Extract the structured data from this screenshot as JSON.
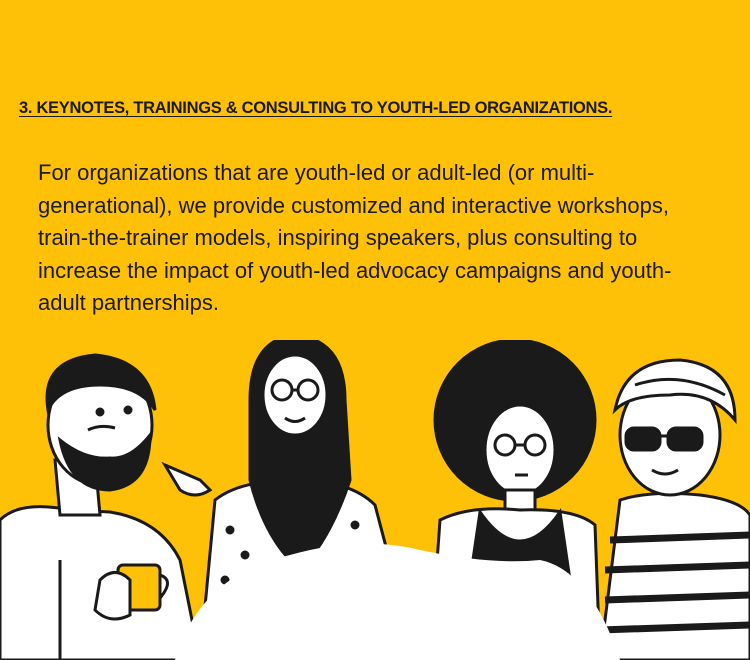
{
  "section": {
    "heading": "3. KEYNOTES, TRAININGS & CONSULTING TO YOUTH-LED ORGANIZATIONS.",
    "body": "For organizations that are youth-led or adult-led (or multi-generational), we provide customized and interactive workshops, train-the-trainer models, inspiring speakers, plus consulting to increase the impact of youth-led advocacy campaigns and youth-adult partnerships."
  },
  "colors": {
    "background": "#FFC107",
    "ink": "#1a1a1a",
    "paper": "#ffffff",
    "mug": "#FFC107"
  },
  "illustration": {
    "people": [
      "bearded-man-with-mug",
      "woman-in-hijab-with-glasses",
      "person-with-afro-and-glasses",
      "person-with-turban-and-sunglasses"
    ]
  }
}
